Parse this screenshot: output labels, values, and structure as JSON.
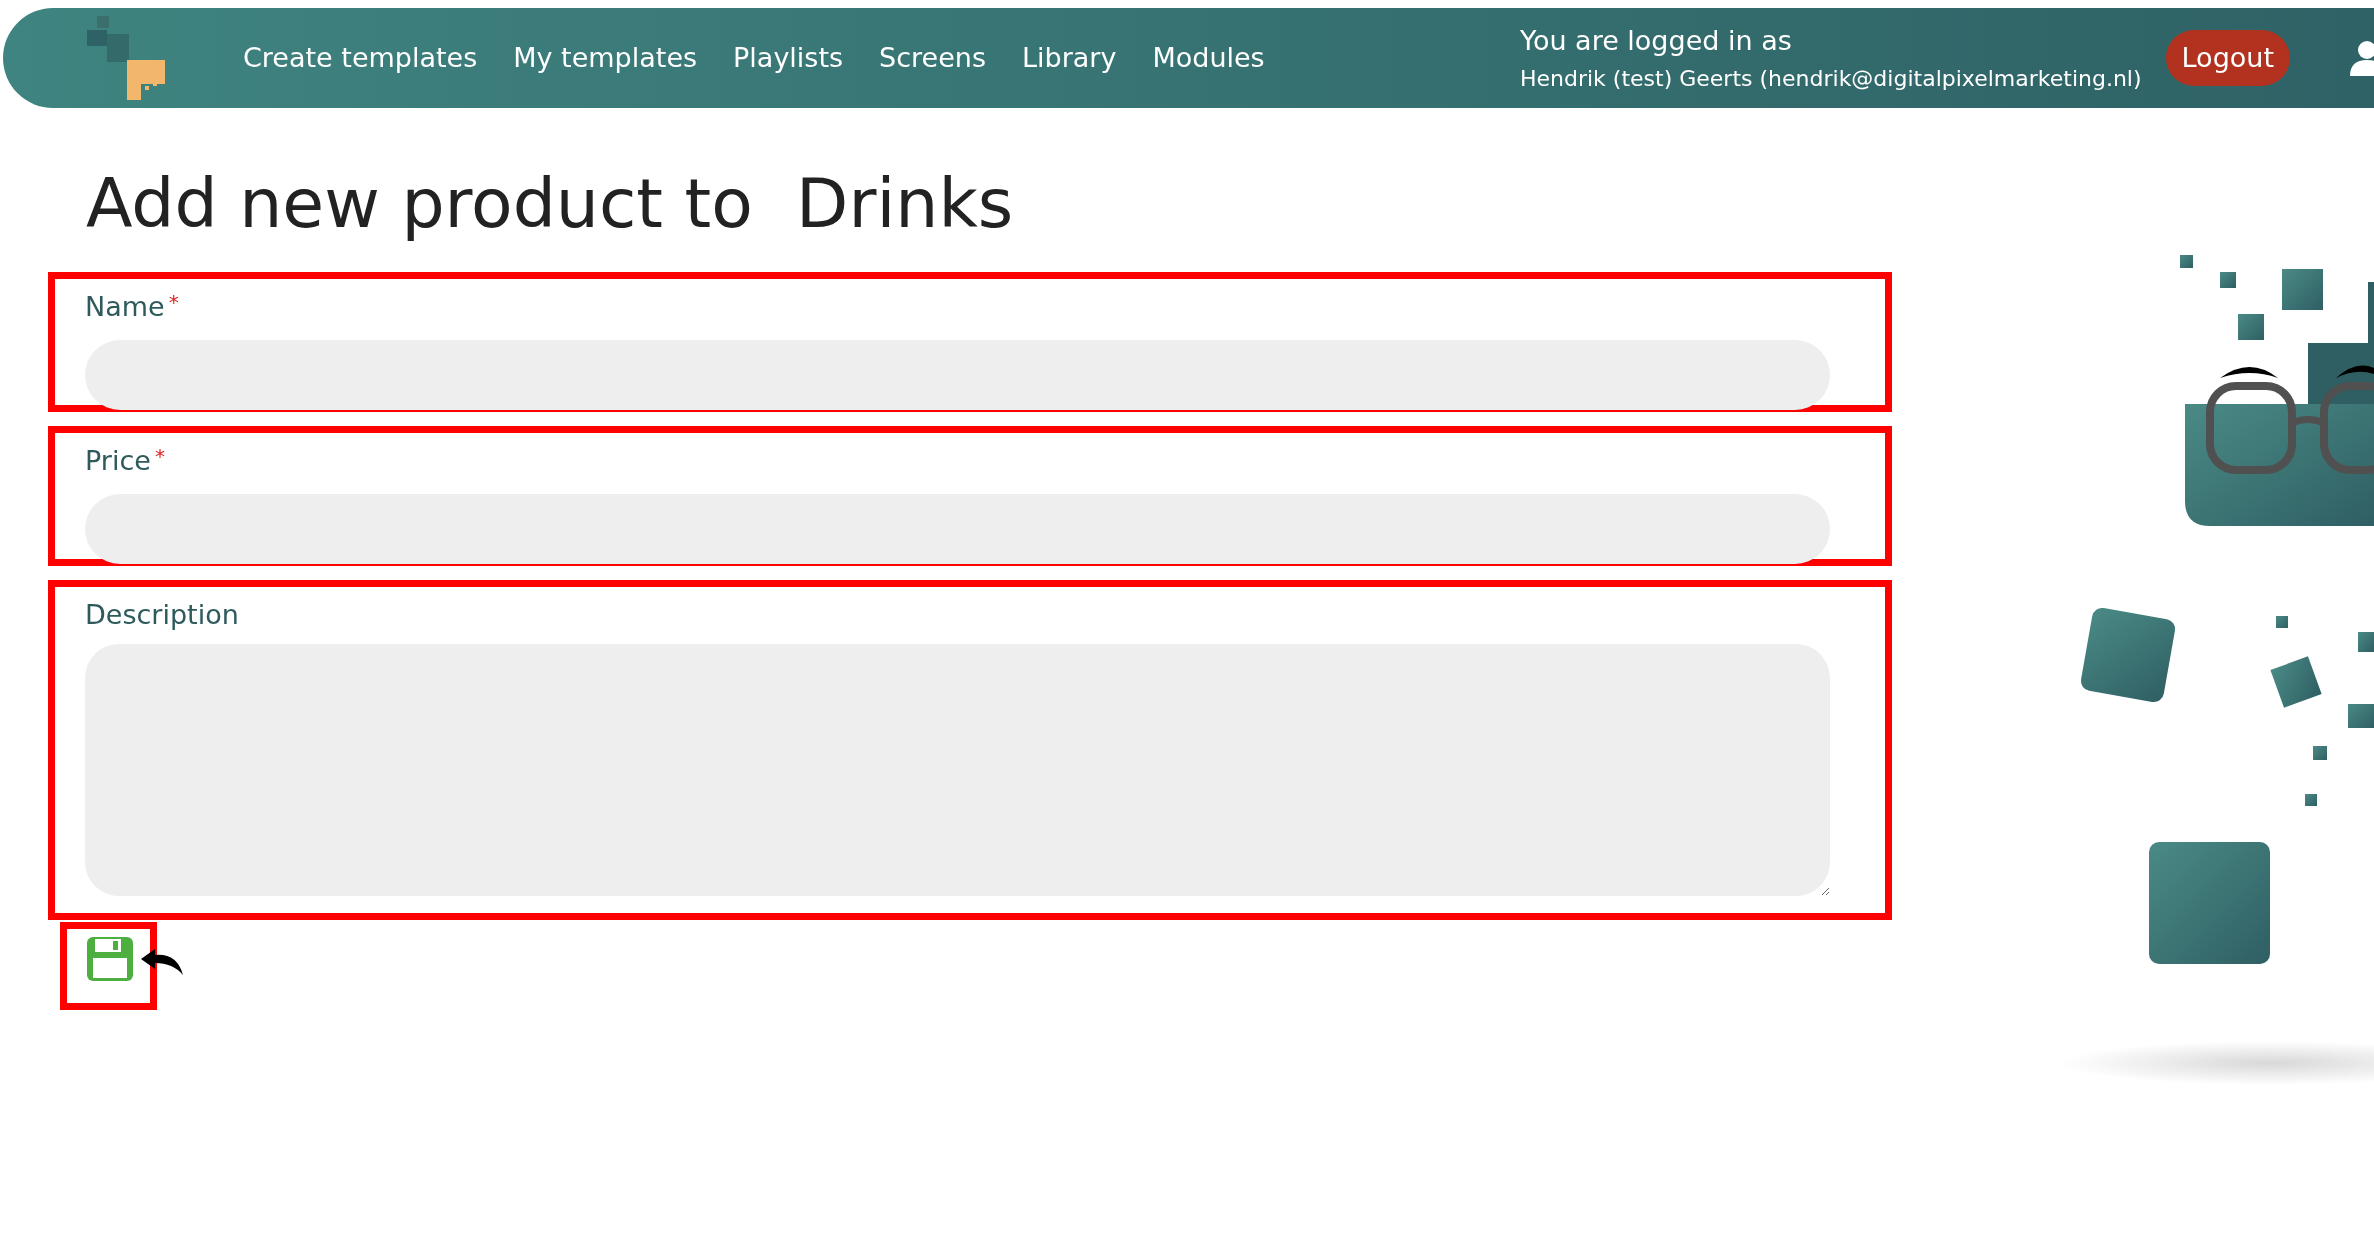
{
  "nav": {
    "links": [
      "Create templates",
      "My templates",
      "Playlists",
      "Screens",
      "Library",
      "Modules"
    ]
  },
  "user": {
    "line_1": "You are logged in as",
    "line_2": "Hendrik (test) Geerts (hendrik@digitalpixelmarketing.nl)",
    "logout": "Logout"
  },
  "title": "Add new product to  Drinks",
  "fields": [
    {
      "label": "Name",
      "required": true,
      "kind": "input"
    },
    {
      "label": "Price",
      "required": true,
      "kind": "input"
    },
    {
      "label": "Description",
      "required": false,
      "kind": "textarea"
    }
  ],
  "required_mark": "*"
}
